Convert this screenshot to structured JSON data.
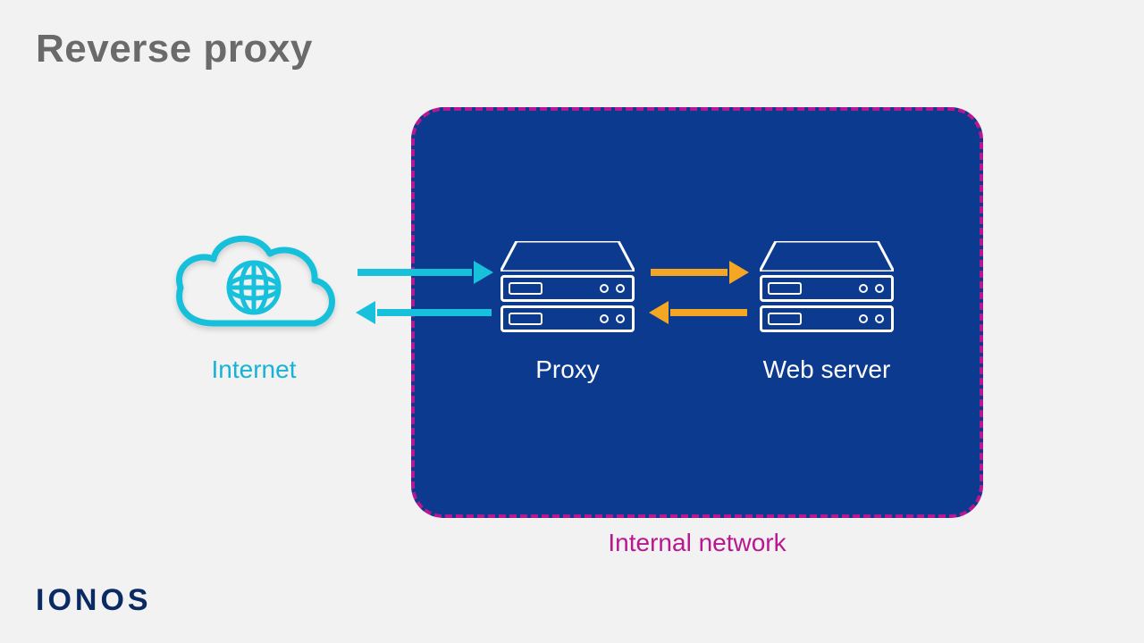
{
  "title": "Reverse proxy",
  "brand": "IONOS",
  "nodes": {
    "internet": {
      "label": "Internet"
    },
    "proxy": {
      "label": "Proxy"
    },
    "webserver": {
      "label": "Web server"
    }
  },
  "zone": {
    "label": "Internal network"
  },
  "colors": {
    "background": "#f2f2f2",
    "title": "#6a6a6a",
    "brand": "#0b2a63",
    "zone_fill": "#0b3a8f",
    "zone_border": "#b8178f",
    "internet": "#17c0db",
    "internal_arrow": "#f5a623",
    "server_stroke": "#ffffff"
  }
}
